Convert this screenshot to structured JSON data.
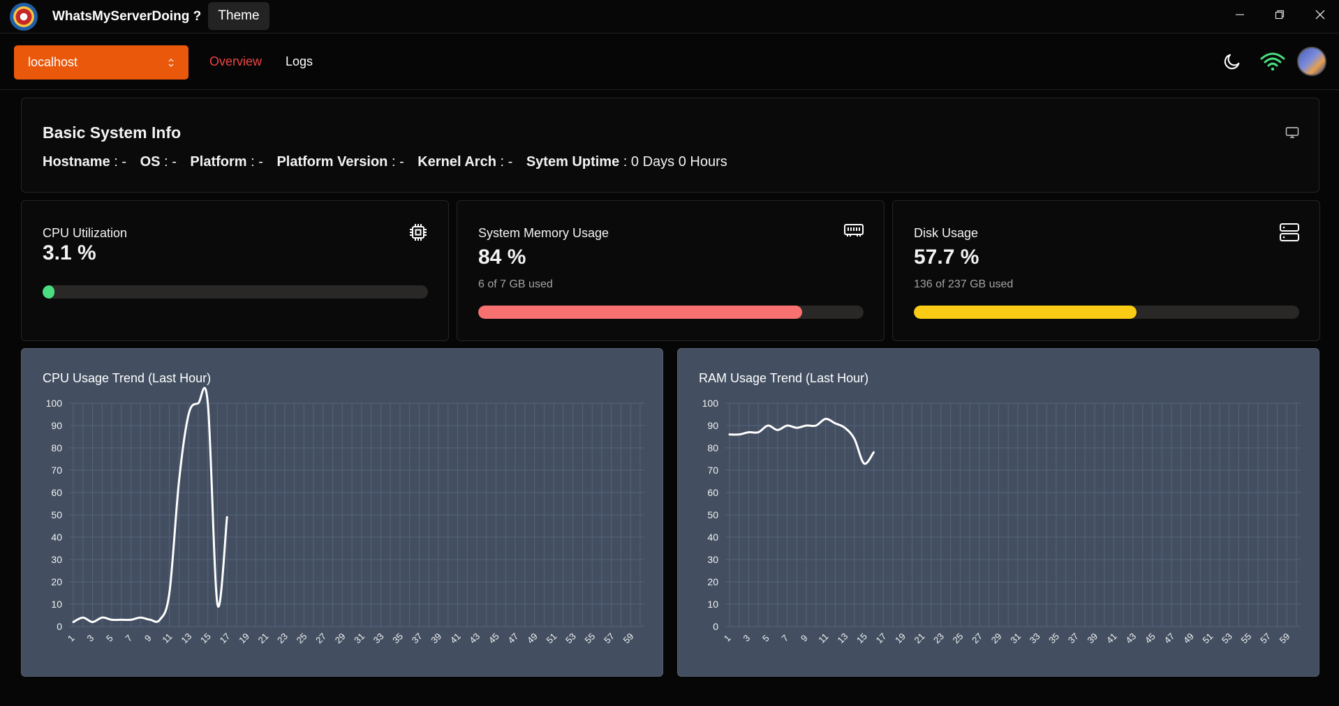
{
  "window": {
    "title": "WhatsMyServerDoing ?",
    "theme_label": "Theme"
  },
  "nav": {
    "server": "localhost",
    "links": [
      "Overview",
      "Logs"
    ],
    "active": "Overview",
    "icons": [
      "moon-icon",
      "wifi-icon",
      "avatar"
    ]
  },
  "system_info": {
    "title": "Basic System Info",
    "fields": [
      {
        "key": "Hostname",
        "value": "-"
      },
      {
        "key": "OS",
        "value": "-"
      },
      {
        "key": "Platform",
        "value": "-"
      },
      {
        "key": "Platform Version",
        "value": "-"
      },
      {
        "key": "Kernel Arch",
        "value": "-"
      },
      {
        "key": "Sytem Uptime",
        "value": "0 Days 0 Hours"
      }
    ]
  },
  "stats": {
    "cpu": {
      "label": "CPU Utilization",
      "value": "3.1 %",
      "percent": 3.1,
      "color": "#4ade80",
      "icon": "cpu-icon"
    },
    "memory": {
      "label": "System Memory Usage",
      "value": "84 %",
      "sub": "6 of 7 GB used",
      "percent": 84,
      "color": "#f87171",
      "icon": "memory-icon"
    },
    "disk": {
      "label": "Disk Usage",
      "value": "57.7 %",
      "sub": "136 of 237 GB used",
      "percent": 57.7,
      "color": "#facc15",
      "icon": "server-icon"
    }
  },
  "chart_data": [
    {
      "type": "line",
      "title": "CPU Usage Trend (Last Hour)",
      "xlabel": "",
      "ylabel": "",
      "x": [
        1,
        2,
        3,
        4,
        5,
        6,
        7,
        8,
        9,
        10,
        11,
        12,
        13,
        14,
        15,
        16,
        17,
        18,
        19,
        20,
        21,
        22,
        23,
        24,
        25,
        26,
        27,
        28,
        29,
        30,
        31,
        32,
        33,
        34,
        35,
        36,
        37,
        38,
        39,
        40,
        41,
        42,
        43,
        44,
        45,
        46,
        47,
        48,
        49,
        50,
        51,
        52,
        53,
        54,
        55,
        56,
        57,
        58,
        59,
        60
      ],
      "x_tick_labels": [
        "1",
        "3",
        "5",
        "7",
        "9",
        "11",
        "13",
        "15",
        "17",
        "19",
        "21",
        "23",
        "25",
        "27",
        "29",
        "31",
        "33",
        "35",
        "37",
        "39",
        "41",
        "43",
        "45",
        "47",
        "49",
        "51",
        "53",
        "55",
        "57",
        "59"
      ],
      "ylim": [
        0,
        100
      ],
      "y_ticks": [
        0,
        10,
        20,
        30,
        40,
        50,
        60,
        70,
        80,
        90,
        100
      ],
      "grid": true,
      "series": [
        {
          "values": [
            2,
            4,
            2,
            4,
            3,
            3,
            3,
            4,
            3,
            3,
            15,
            65,
            95,
            100,
            100,
            10,
            49
          ]
        }
      ]
    },
    {
      "type": "line",
      "title": "RAM Usage Trend (Last Hour)",
      "xlabel": "",
      "ylabel": "",
      "x": [
        1,
        2,
        3,
        4,
        5,
        6,
        7,
        8,
        9,
        10,
        11,
        12,
        13,
        14,
        15,
        16,
        17,
        18,
        19,
        20,
        21,
        22,
        23,
        24,
        25,
        26,
        27,
        28,
        29,
        30,
        31,
        32,
        33,
        34,
        35,
        36,
        37,
        38,
        39,
        40,
        41,
        42,
        43,
        44,
        45,
        46,
        47,
        48,
        49,
        50,
        51,
        52,
        53,
        54,
        55,
        56,
        57,
        58,
        59,
        60
      ],
      "x_tick_labels": [
        "1",
        "3",
        "5",
        "7",
        "9",
        "11",
        "13",
        "15",
        "17",
        "19",
        "21",
        "23",
        "25",
        "27",
        "29",
        "31",
        "33",
        "35",
        "37",
        "39",
        "41",
        "43",
        "45",
        "47",
        "49",
        "51",
        "53",
        "55",
        "57",
        "59"
      ],
      "ylim": [
        0,
        100
      ],
      "y_ticks": [
        0,
        10,
        20,
        30,
        40,
        50,
        60,
        70,
        80,
        90,
        100
      ],
      "grid": true,
      "series": [
        {
          "values": [
            86,
            86,
            87,
            87,
            90,
            88,
            90,
            89,
            90,
            90,
            93,
            91,
            89,
            84,
            73,
            78
          ]
        }
      ]
    }
  ]
}
